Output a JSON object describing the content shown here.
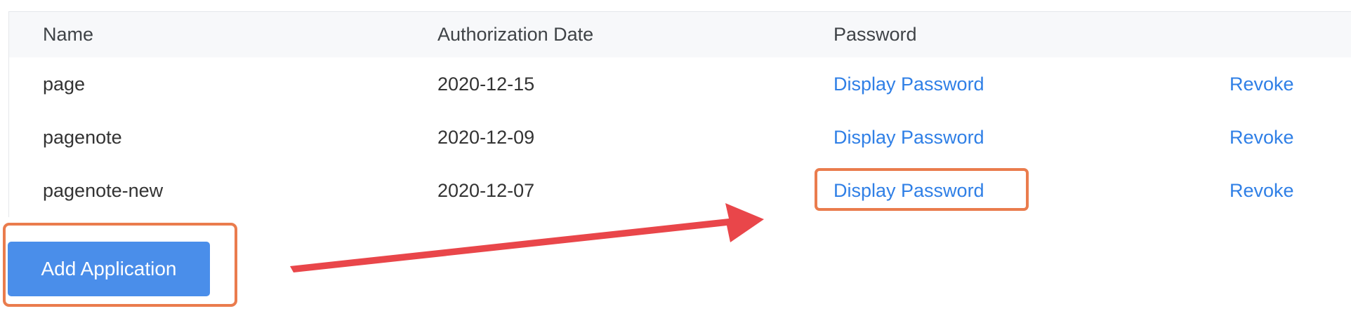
{
  "table": {
    "headers": {
      "name": "Name",
      "date": "Authorization Date",
      "password": "Password"
    },
    "rows": [
      {
        "name": "page",
        "date": "2020-12-15",
        "password_link": "Display Password",
        "action": "Revoke"
      },
      {
        "name": "pagenote",
        "date": "2020-12-09",
        "password_link": "Display Password",
        "action": "Revoke"
      },
      {
        "name": "pagenote-new",
        "date": "2020-12-07",
        "password_link": "Display Password",
        "action": "Revoke"
      }
    ]
  },
  "actions": {
    "add_application": "Add Application"
  },
  "annotations": {
    "highlight_color": "#ea7c4d",
    "arrow_color": "#e9464a"
  },
  "colors": {
    "link": "#2f7fe6",
    "primary_button": "#4a8eea",
    "header_background": "#f7f8fa"
  }
}
